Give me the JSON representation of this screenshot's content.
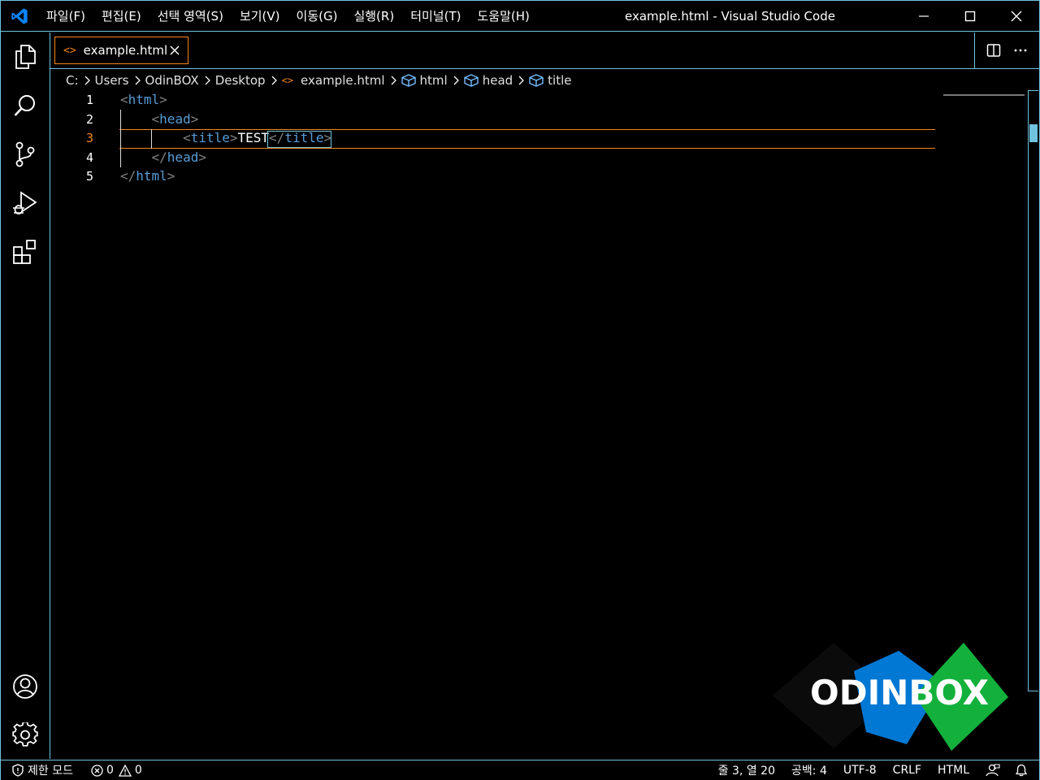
{
  "window": {
    "title": "example.html - Visual Studio Code"
  },
  "menu": [
    {
      "label": "파일(F)"
    },
    {
      "label": "편집(E)"
    },
    {
      "label": "선택 영역(S)"
    },
    {
      "label": "보기(V)"
    },
    {
      "label": "이동(G)"
    },
    {
      "label": "실행(R)"
    },
    {
      "label": "터미널(T)"
    },
    {
      "label": "도움말(H)"
    }
  ],
  "activity_bar": {
    "items": [
      "explorer-icon",
      "search-icon",
      "source-control-icon",
      "run-debug-icon",
      "extensions-icon"
    ],
    "bottom_items": [
      "account-icon",
      "settings-gear-icon"
    ]
  },
  "tab": {
    "icon": "<>",
    "label": "example.html"
  },
  "breadcrumb": {
    "items": [
      {
        "label": "C:"
      },
      {
        "label": "Users"
      },
      {
        "label": "OdinBOX"
      },
      {
        "label": "Desktop"
      },
      {
        "label": "example.html",
        "icon": "html-file-icon"
      },
      {
        "label": "html",
        "icon": "symbol-element-icon"
      },
      {
        "label": "head",
        "icon": "symbol-element-icon"
      },
      {
        "label": "title",
        "icon": "symbol-element-icon"
      }
    ]
  },
  "editor": {
    "line_numbers": [
      "1",
      "2",
      "3",
      "4",
      "5"
    ],
    "active_line": 3,
    "lines": [
      {
        "indent": "",
        "open": "<",
        "tag": "html",
        "close": ">"
      },
      {
        "indent": "    ",
        "open": "<",
        "tag": "head",
        "close": ">"
      },
      {
        "indent": "        ",
        "open": "<",
        "tag": "title",
        "close": ">",
        "text": "TEST",
        "open2": "</",
        "tag2": "title",
        "close2": ">"
      },
      {
        "indent": "    ",
        "open": "</",
        "tag": "head",
        "close": ">"
      },
      {
        "indent": "",
        "open": "</",
        "tag": "html",
        "close": ">"
      }
    ]
  },
  "watermark": {
    "text": "ODINBOX"
  },
  "statusbar": {
    "restricted_mode": "제한 모드",
    "errors": "0",
    "warnings": "0",
    "cursor_position": "줄 3, 열 20",
    "indentation": "공백: 4",
    "encoding": "UTF-8",
    "eol": "CRLF",
    "language": "HTML"
  },
  "colors": {
    "accent_border": "#6fc3df",
    "active_orange": "#f38518",
    "tag_blue": "#569cd6",
    "logo_black": "#0b0b0b",
    "logo_blue": "#0078d4",
    "logo_green": "#13b13c"
  }
}
